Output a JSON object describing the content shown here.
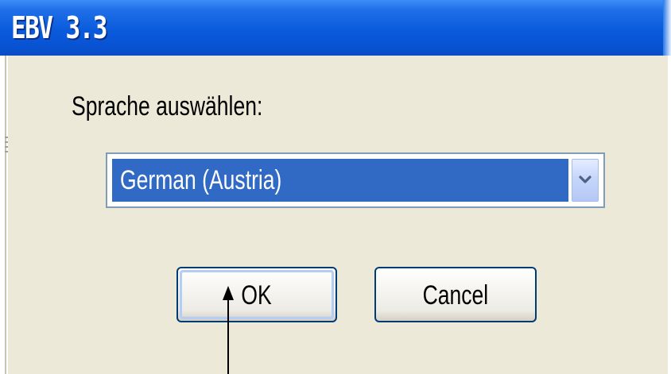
{
  "window": {
    "title": "EBV 3.3"
  },
  "dialog": {
    "prompt_label": "Sprache auswählen:",
    "language_select": {
      "selected_value": "German (Austria)"
    },
    "buttons": {
      "ok_label": "OK",
      "cancel_label": "Cancel"
    }
  },
  "colors": {
    "titlebar": "#0a5bdc",
    "client_background": "#ece9d8",
    "selection_highlight": "#316ac5",
    "button_border": "#003c74"
  },
  "icons": {
    "dropdown": "chevron-down-icon",
    "annotation": "arrow-up-icon"
  }
}
